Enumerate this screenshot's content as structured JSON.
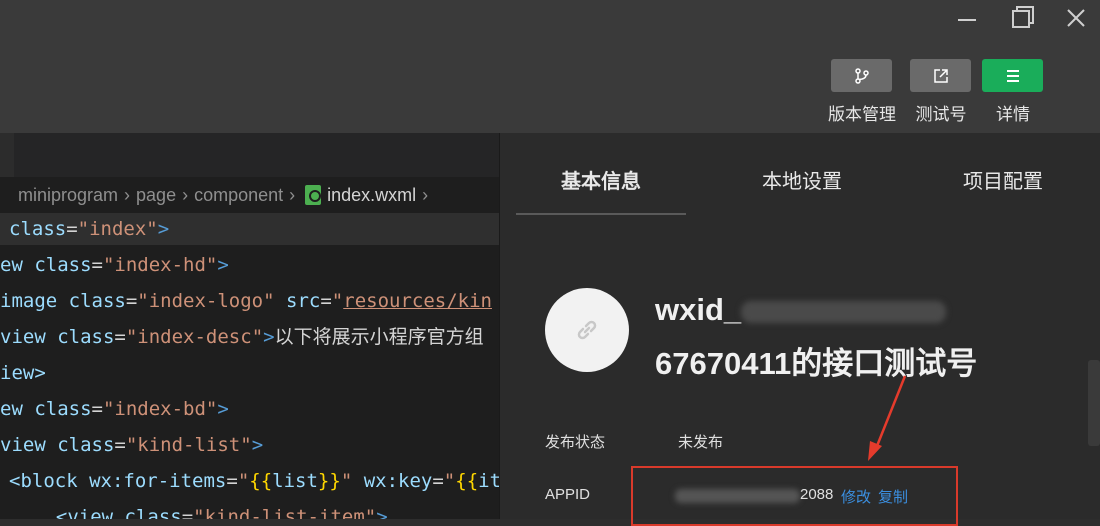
{
  "window": {
    "controls": [
      "minimize-icon",
      "maximize-icon",
      "close-icon"
    ]
  },
  "toolbar": {
    "buttons": [
      {
        "label": "版本管理",
        "icon": "branch-icon"
      },
      {
        "label": "测试号",
        "icon": "external-link-icon"
      },
      {
        "label": "详情",
        "icon": "menu-icon"
      }
    ],
    "accent_color": "#1aad5a"
  },
  "editor": {
    "breadcrumb": [
      "miniprogram",
      "page",
      "component",
      "index.wxml"
    ],
    "lines": [
      [
        {
          "t": "class",
          "c": "attr"
        },
        {
          "t": "=",
          "c": "text"
        },
        {
          "t": "\"index\"",
          "c": "str"
        },
        {
          "t": ">",
          "c": "tag"
        }
      ],
      [
        {
          "t": "ew ",
          "c": "attr"
        },
        {
          "t": "class",
          "c": "attr"
        },
        {
          "t": "=",
          "c": "text"
        },
        {
          "t": "\"index-hd\"",
          "c": "str"
        },
        {
          "t": ">",
          "c": "tag"
        }
      ],
      [
        {
          "t": "image ",
          "c": "attr"
        },
        {
          "t": "class",
          "c": "attr"
        },
        {
          "t": "=",
          "c": "text"
        },
        {
          "t": "\"index-logo\"",
          "c": "str"
        },
        {
          "t": " src",
          "c": "attr"
        },
        {
          "t": "=",
          "c": "text"
        },
        {
          "t": "\"",
          "c": "str"
        },
        {
          "t": "resources/kin",
          "c": "url"
        }
      ],
      [
        {
          "t": "view ",
          "c": "attr"
        },
        {
          "t": "class",
          "c": "attr"
        },
        {
          "t": "=",
          "c": "text"
        },
        {
          "t": "\"index-desc\"",
          "c": "str"
        },
        {
          "t": ">",
          "c": "tag"
        },
        {
          "t": "以下将展示小程序官方组",
          "c": "text"
        }
      ],
      [
        {
          "t": "iew>",
          "c": "attr"
        }
      ],
      [
        {
          "t": "ew ",
          "c": "attr"
        },
        {
          "t": "class",
          "c": "attr"
        },
        {
          "t": "=",
          "c": "text"
        },
        {
          "t": "\"index-bd\"",
          "c": "str"
        },
        {
          "t": ">",
          "c": "tag"
        }
      ],
      [
        {
          "t": "view ",
          "c": "attr"
        },
        {
          "t": "class",
          "c": "attr"
        },
        {
          "t": "=",
          "c": "text"
        },
        {
          "t": "\"kind-list\"",
          "c": "str"
        },
        {
          "t": ">",
          "c": "tag"
        }
      ],
      [
        {
          "t": "<block ",
          "c": "attr"
        },
        {
          "t": "wx:for-items",
          "c": "attr"
        },
        {
          "t": "=",
          "c": "text"
        },
        {
          "t": "\"",
          "c": "str"
        },
        {
          "t": "{{",
          "c": "brace"
        },
        {
          "t": "list",
          "c": "attr"
        },
        {
          "t": "}}",
          "c": "brace"
        },
        {
          "t": "\"",
          "c": "str"
        },
        {
          "t": " wx:key",
          "c": "attr"
        },
        {
          "t": "=",
          "c": "text"
        },
        {
          "t": "\"",
          "c": "str"
        },
        {
          "t": "{{",
          "c": "brace"
        },
        {
          "t": "it",
          "c": "attr"
        }
      ],
      [
        {
          "t": "  <view ",
          "c": "attr"
        },
        {
          "t": "class",
          "c": "attr"
        },
        {
          "t": "=",
          "c": "text"
        },
        {
          "t": "\"kind-list-item\"",
          "c": "str"
        },
        {
          "t": ">",
          "c": "tag"
        }
      ]
    ]
  },
  "details": {
    "tabs": [
      "基本信息",
      "本地设置",
      "项目配置"
    ],
    "project_title_prefix": "wxid_",
    "project_title_suffix": "67670411的接口测试号",
    "fields": [
      {
        "label": "发布状态",
        "value": "未发布"
      },
      {
        "label": "APPID",
        "value": "2088"
      }
    ],
    "appid_links": [
      "修改",
      "复制"
    ],
    "link_color": "#3b8fe0",
    "highlight_color": "#d93a2b"
  }
}
